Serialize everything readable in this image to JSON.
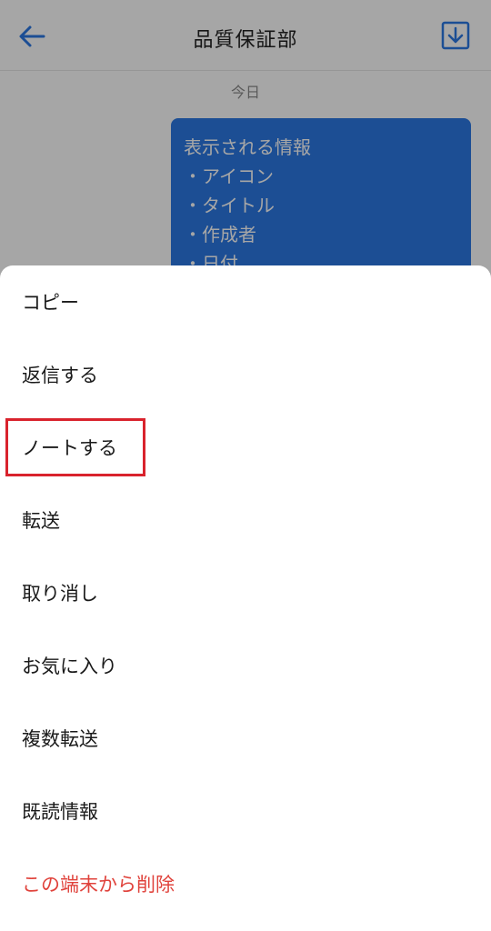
{
  "header": {
    "title": "品質保証部",
    "back_icon": "arrow-left-icon",
    "download_icon": "download-icon"
  },
  "chat": {
    "date_label": "今日",
    "message_lines": [
      "表示される情報",
      "・アイコン",
      "・タイトル",
      "・作成者",
      "・日付"
    ]
  },
  "action_sheet": {
    "items": [
      {
        "label": "コピー"
      },
      {
        "label": "返信する"
      },
      {
        "label": "ノートする"
      },
      {
        "label": "転送"
      },
      {
        "label": "取り消し"
      },
      {
        "label": "お気に入り"
      },
      {
        "label": "複数転送"
      },
      {
        "label": "既読情報"
      },
      {
        "label": "この端末から削除"
      }
    ]
  },
  "colors": {
    "accent": "#2b78e4",
    "danger": "#e0433c",
    "highlight": "#d9232d"
  }
}
